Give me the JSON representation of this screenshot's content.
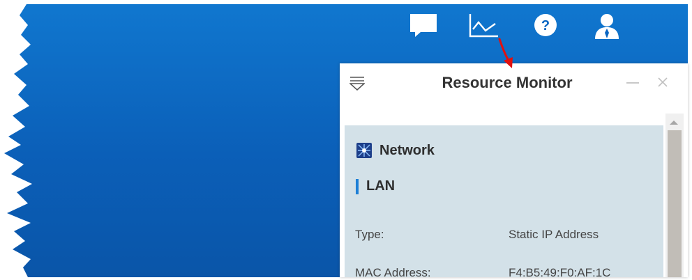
{
  "header_icons": {
    "chat": "chat-bubble-icon",
    "monitor": "line-chart-icon",
    "help": "help-circle-icon",
    "user": "user-icon"
  },
  "window": {
    "title": "Resource Monitor",
    "menu_icon": "filter-menu-icon",
    "minimize_icon": "minimize-icon",
    "close_icon": "close-icon"
  },
  "network": {
    "title": "Network",
    "icon": "network-icon",
    "section": "LAN",
    "rows": [
      {
        "label": "Type:",
        "value": "Static IP Address"
      },
      {
        "label": "MAC Address:",
        "value": "F4:B5:49:F0:AF:1C"
      }
    ]
  },
  "colors": {
    "desktop": "#0b66c2",
    "panel": "#d3e1e8",
    "accent": "#1d7fd6",
    "arrow": "#e01010"
  }
}
